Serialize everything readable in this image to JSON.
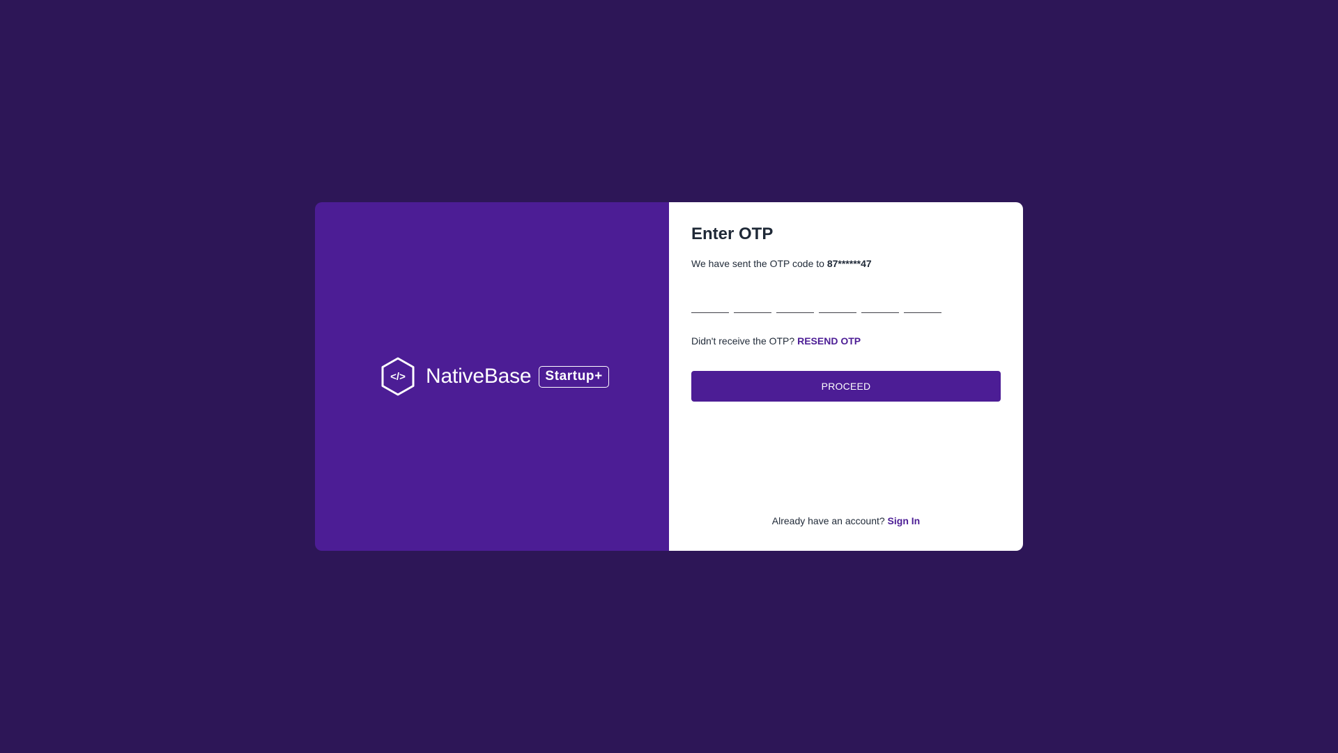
{
  "brand": {
    "name": "NativeBase",
    "badge": "Startup+",
    "logo_glyph": "</>",
    "colors": {
      "panel": "#4c1d95",
      "background": "#2d1657"
    }
  },
  "form": {
    "title": "Enter OTP",
    "sent_prefix": "We have sent the OTP code to ",
    "phone_masked": "87******47",
    "otp_digits": [
      "",
      "",
      "",
      "",
      "",
      ""
    ],
    "resend_prompt": "Didn't receive the OTP? ",
    "resend_label": "RESEND OTP",
    "proceed_label": "PROCEED",
    "signin_prompt": "Already have an account? ",
    "signin_label": "Sign In",
    "accent_color": "#4c1d95"
  }
}
